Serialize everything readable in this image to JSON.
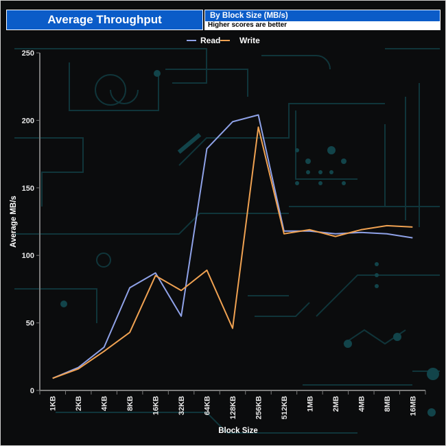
{
  "header": {
    "title": "Average Throughput",
    "subtitle": "By Block Size (MB/s)",
    "note": "Higher scores are better"
  },
  "colors": {
    "read": "#8fa2e8",
    "write": "#f0a252",
    "header_blue": "#0b5cc8"
  },
  "chart_data": {
    "type": "line",
    "categories": [
      "1KB",
      "2KB",
      "4KB",
      "8KB",
      "16KB",
      "32KB",
      "64KB",
      "128KB",
      "256KB",
      "512KB",
      "1MB",
      "2MB",
      "4MB",
      "8MB",
      "16MB"
    ],
    "series": [
      {
        "name": "Read",
        "values": [
          9,
          17,
          32,
          76,
          87,
          55,
          179,
          199,
          204,
          118,
          118,
          116,
          117,
          116,
          113
        ]
      },
      {
        "name": "Write",
        "values": [
          9,
          16,
          29,
          43,
          85,
          74,
          89,
          46,
          195,
          116,
          119,
          114,
          119,
          122,
          121
        ]
      }
    ],
    "xlabel": "Block Size",
    "ylabel": "Average MB/s",
    "ylim": [
      0,
      250
    ],
    "yticks": [
      "0",
      "50",
      "100",
      "150",
      "200",
      "250"
    ],
    "legend": "top-center",
    "grid": false
  }
}
